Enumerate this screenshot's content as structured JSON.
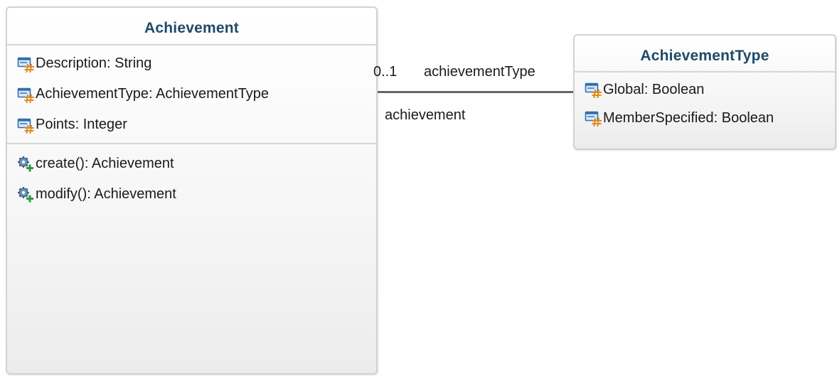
{
  "diagram": {
    "classes": [
      {
        "name": "Achievement",
        "attributes": [
          {
            "label": "Description: String",
            "icon": "attribute-icon"
          },
          {
            "label": "AchievementType: AchievementType",
            "icon": "attribute-icon"
          },
          {
            "label": "Points: Integer",
            "icon": "attribute-icon"
          }
        ],
        "operations": [
          {
            "label": "create(): Achievement",
            "icon": "operation-icon"
          },
          {
            "label": "modify(): Achievement",
            "icon": "operation-icon"
          }
        ]
      },
      {
        "name": "AchievementType",
        "attributes": [
          {
            "label": "Global: Boolean",
            "icon": "attribute-icon"
          },
          {
            "label": "MemberSpecified: Boolean",
            "icon": "attribute-icon"
          }
        ],
        "operations": []
      }
    ],
    "association": {
      "target_multiplicity": "0..1",
      "target_role": "achievementType",
      "source_role": "achievement"
    }
  },
  "colors": {
    "class_title": "#1f4a68",
    "line": "#666666",
    "border": "#d2d2d2",
    "icon_blue": "#2f6fae",
    "icon_orange": "#e08a1e",
    "icon_green": "#2e9a3a"
  }
}
